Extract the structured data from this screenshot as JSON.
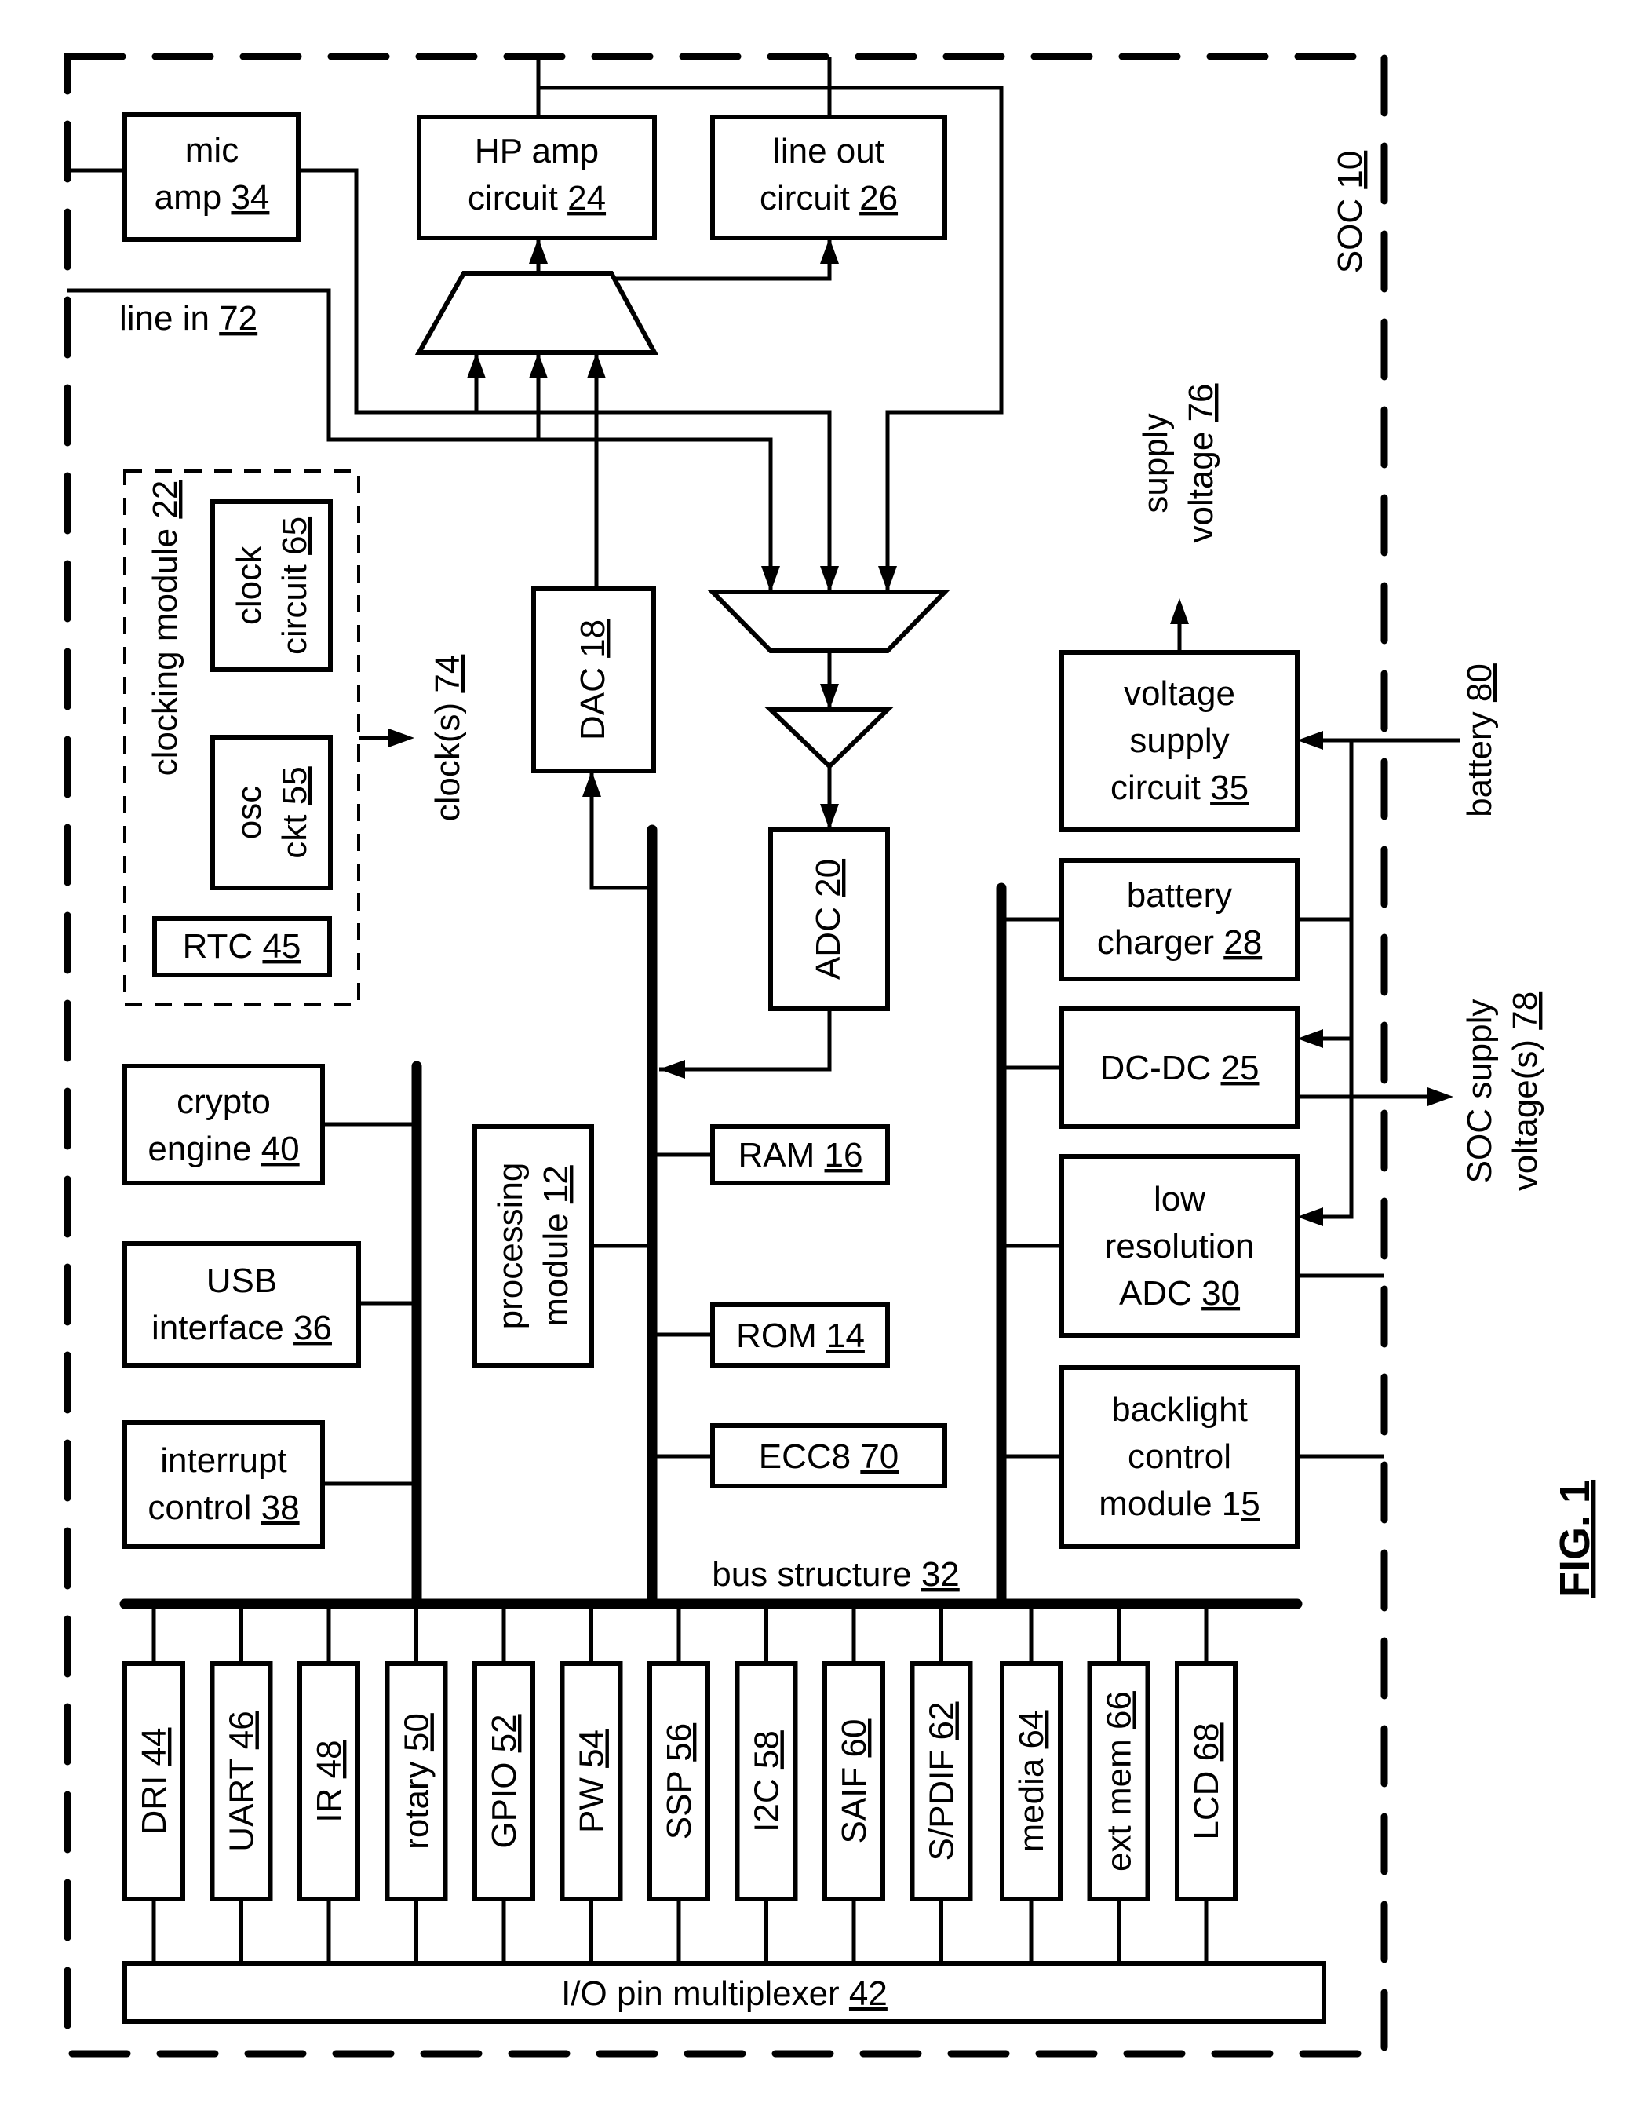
{
  "figure": {
    "label": "FIG. 1",
    "soc": {
      "name": "SOC",
      "ref": "10"
    }
  },
  "blocks": {
    "mic_amp": {
      "lines": [
        "mic",
        "amp"
      ],
      "ref": "34"
    },
    "hp_amp": {
      "lines": [
        "HP amp",
        "circuit"
      ],
      "ref": "24"
    },
    "line_out": {
      "lines": [
        "line out",
        "circuit"
      ],
      "ref": "26"
    },
    "line_in": {
      "text": "line in",
      "ref": "72"
    },
    "clocking_module": {
      "text": "clocking module",
      "ref": "22"
    },
    "clock_circuit": {
      "lines": [
        "clock",
        "circuit"
      ],
      "ref": "65"
    },
    "osc_ckt": {
      "lines": [
        "osc",
        "ckt"
      ],
      "ref": "55"
    },
    "rtc": {
      "text": "RTC",
      "ref": "45"
    },
    "clocks": {
      "text": "clock(s)",
      "ref": "74"
    },
    "dac": {
      "text": "DAC",
      "ref": "18"
    },
    "adc": {
      "text": "ADC",
      "ref": "20"
    },
    "supply_voltage": {
      "lines": [
        "supply",
        "voltage"
      ],
      "ref": "76"
    },
    "voltage_supply_circuit": {
      "lines": [
        "voltage",
        "supply",
        "circuit"
      ],
      "ref": "35"
    },
    "battery": {
      "text": "battery",
      "ref": "80"
    },
    "battery_charger": {
      "lines": [
        "battery",
        "charger"
      ],
      "ref": "28"
    },
    "dc_dc": {
      "text": "DC-DC",
      "ref": "25"
    },
    "soc_supply": {
      "lines": [
        "SOC supply",
        "voltage(s)"
      ],
      "ref": "78"
    },
    "low_res_adc": {
      "lines": [
        "low",
        "resolution",
        "ADC"
      ],
      "ref": "30"
    },
    "backlight": {
      "lines": [
        "backlight",
        "control",
        "module 1"
      ],
      "ref": "5"
    },
    "crypto": {
      "lines": [
        "crypto",
        "engine"
      ],
      "ref": "40"
    },
    "usb": {
      "lines": [
        "USB",
        "interface"
      ],
      "ref": "36"
    },
    "interrupt": {
      "lines": [
        "interrupt",
        "control"
      ],
      "ref": "38"
    },
    "processing": {
      "lines": [
        "processing",
        "module"
      ],
      "ref": "12"
    },
    "ram": {
      "text": "RAM",
      "ref": "16"
    },
    "rom": {
      "text": "ROM",
      "ref": "14"
    },
    "ecc8": {
      "text": "ECC8",
      "ref": "70"
    },
    "bus_structure": {
      "text": "bus structure",
      "ref": "32"
    },
    "io_mux": {
      "text": "I/O pin multiplexer",
      "ref": "42"
    }
  },
  "pins": [
    {
      "text": "DRI",
      "ref": "44"
    },
    {
      "text": "UART",
      "ref": "46"
    },
    {
      "text": "IR",
      "ref": "48"
    },
    {
      "text": "rotary",
      "ref": "50"
    },
    {
      "text": "GPIO",
      "ref": "52"
    },
    {
      "text": "PW",
      "ref": "54"
    },
    {
      "text": "SSP",
      "ref": "56"
    },
    {
      "text": "I2C",
      "ref": "58"
    },
    {
      "text": "SAIF",
      "ref": "60"
    },
    {
      "text": "S/PDIF",
      "ref": "62"
    },
    {
      "text": "media",
      "ref": "64"
    },
    {
      "text": "ext mem",
      "ref": "66"
    },
    {
      "text": "LCD",
      "ref": "68"
    }
  ]
}
